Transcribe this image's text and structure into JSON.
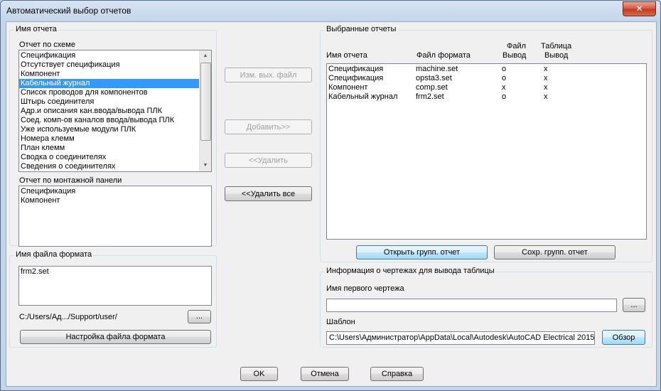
{
  "window": {
    "title": "Автоматический выбор отчетов",
    "close_glyph": "✕"
  },
  "left": {
    "report_name_group": "Имя отчета",
    "schematic_label": "Отчет по схеме",
    "schematic_items": [
      "Спецификация",
      "Отсутствует спецификация",
      "Компонент",
      "Кабельный журнал",
      "Список проводов для компонентов",
      "Штырь соединителя",
      "Адр.и описания кан.ввода/вывода ПЛК",
      "Соед. комп-ов каналов ввода/вывода ПЛК",
      "Уже используемые модули ПЛК",
      "Номера клемм",
      "План клемм",
      "Сводка о соединителях",
      "Сведения о соединителях"
    ],
    "schematic_selected": "Кабельный журнал",
    "panel_label": "Отчет по монтажной панели",
    "panel_items": [
      "Спецификация",
      "Компонент"
    ],
    "format_group": "Имя файла формата",
    "format_value": "frm2.set",
    "format_path": "C:/Users/Ад.../Support/user/",
    "browse_label": "...",
    "format_setup_button": "Настройка файла формата"
  },
  "middle": {
    "change_output_button": "Изм. вых. файл",
    "add_button": "Добавить>>",
    "remove_button": "<<Удалить",
    "remove_all_button": "<<Удалить все"
  },
  "right": {
    "selected_group": "Выбранные отчеты",
    "headers": {
      "report_name": "Имя отчета",
      "format_file": "Файл формата",
      "file_output_top": "Файл",
      "file_output_bottom": "Вывод",
      "table_output_top": "Таблица",
      "table_output_bottom": "Вывод"
    },
    "rows": [
      {
        "name": "Спецификация",
        "format": "machine.set",
        "file": "o",
        "table": "x"
      },
      {
        "name": "Спецификация",
        "format": "opsta3.set",
        "file": "o",
        "table": "x"
      },
      {
        "name": "Компонент",
        "format": "comp.set",
        "file": "x",
        "table": "x"
      },
      {
        "name": "Кабельный журнал",
        "format": "frm2.set",
        "file": "o",
        "table": "x"
      }
    ],
    "open_group_button": "Открыть групп. отчет",
    "save_group_button": "Сохр. групп. отчет",
    "drawing_info_group": "Информация о чертежах для вывода таблицы",
    "first_drawing_label": "Имя первого чертежа",
    "first_drawing_value": "",
    "browse_label": "...",
    "template_label": "Шаблон",
    "template_value": "C:\\Users\\Администратор\\AppData\\Local\\Autodesk\\AutoCAD Electrical 2015",
    "browse_template_button": "Обзор"
  },
  "footer": {
    "ok_button": "OK",
    "cancel_button": "Отмена",
    "help_button": "Справка"
  }
}
